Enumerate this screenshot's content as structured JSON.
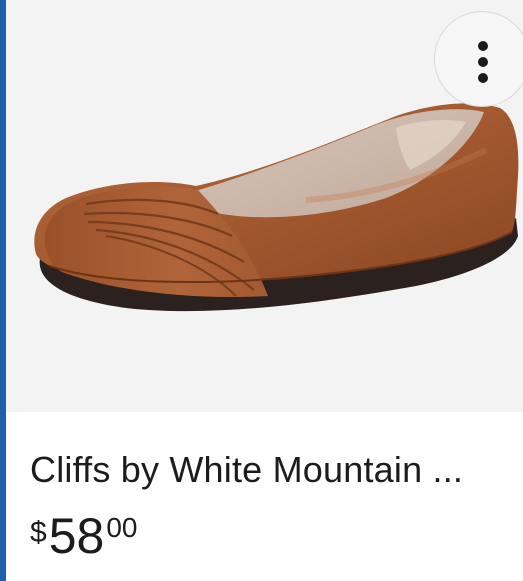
{
  "product": {
    "title": "Cliffs by White Mountain ...",
    "price": {
      "currency": "$",
      "dollars": "58",
      "cents": "00"
    },
    "image": {
      "alt": "Cliffs by White Mountain brown leather ballet flat"
    }
  },
  "menu": {
    "icon": "more-vertical-icon"
  },
  "colors": {
    "accent_border": "#1f5fb0",
    "image_background": "#f3f3f3",
    "text": "#1c1c1c",
    "shoe_leather": "#a45a30",
    "shoe_sole": "#2b2220"
  }
}
